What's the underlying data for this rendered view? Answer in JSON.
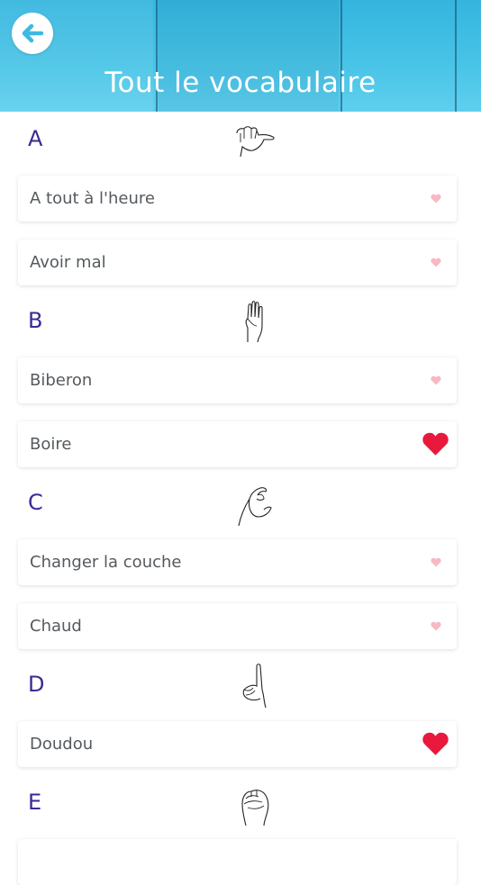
{
  "header": {
    "title": "Tout le vocabulaire",
    "back_icon": "arrow-left-icon",
    "accent_color": "#3db9e2"
  },
  "colors": {
    "letter": "#3b2a91",
    "heart_active": "#e8193c",
    "heart_inactive": "#f6b9c3",
    "label": "#555a5e"
  },
  "sections": [
    {
      "letter": "A",
      "icon": "hand-sign-a-icon",
      "items": [
        {
          "label": "A tout à l'heure",
          "favorite": false
        },
        {
          "label": "Avoir mal",
          "favorite": false
        }
      ]
    },
    {
      "letter": "B",
      "icon": "hand-sign-b-icon",
      "items": [
        {
          "label": "Biberon",
          "favorite": false
        },
        {
          "label": "Boire",
          "favorite": true
        }
      ]
    },
    {
      "letter": "C",
      "icon": "hand-sign-c-icon",
      "items": [
        {
          "label": "Changer la couche",
          "favorite": false
        },
        {
          "label": "Chaud",
          "favorite": false
        }
      ]
    },
    {
      "letter": "D",
      "icon": "hand-sign-d-icon",
      "items": [
        {
          "label": "Doudou",
          "favorite": true
        }
      ]
    },
    {
      "letter": "E",
      "icon": "hand-sign-e-icon",
      "items": [
        {
          "label": "",
          "favorite": false
        }
      ]
    }
  ]
}
